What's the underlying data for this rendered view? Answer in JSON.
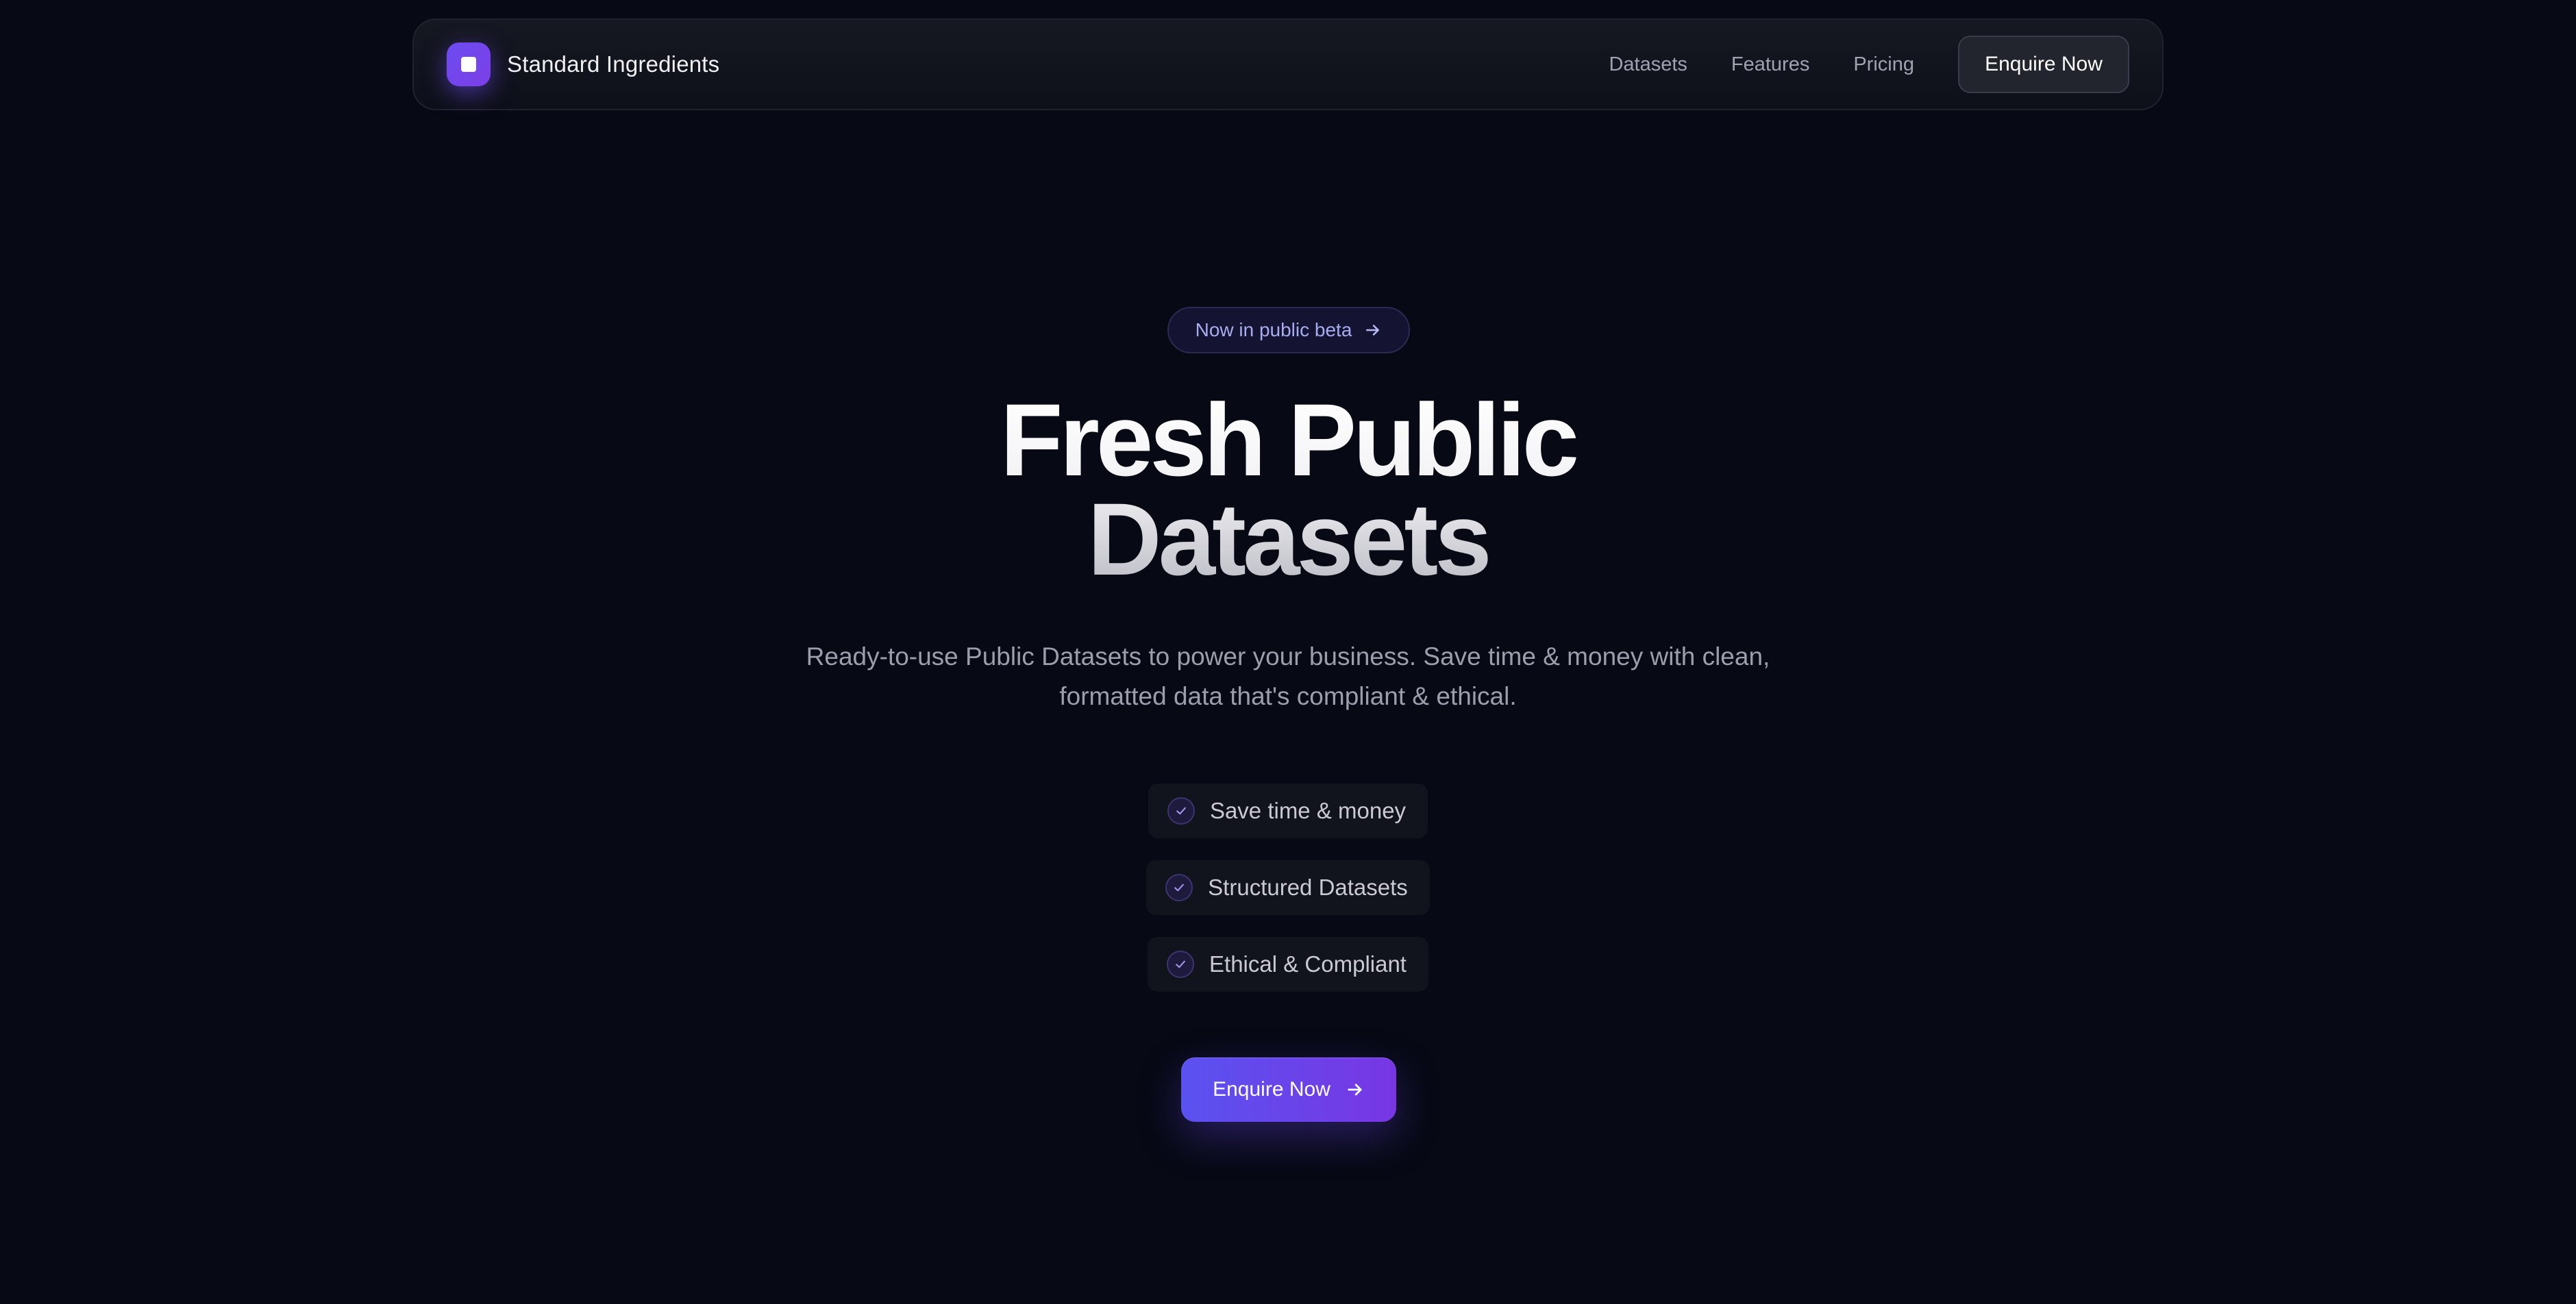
{
  "nav": {
    "brand_name": "Standard Ingredients",
    "logo_icon": "square-logo-icon",
    "links": [
      {
        "label": "Datasets"
      },
      {
        "label": "Features"
      },
      {
        "label": "Pricing"
      }
    ],
    "cta_label": "Enquire Now"
  },
  "hero": {
    "badge_label": "Now in public beta",
    "badge_icon": "arrow-right-icon",
    "title_line1": "Fresh Public",
    "title_line2": "Datasets",
    "subtitle": "Ready-to-use Public Datasets to power your business. Save time & money with clean, formatted data that's compliant & ethical.",
    "features": [
      {
        "label": "Save time & money",
        "icon": "check-icon"
      },
      {
        "label": "Structured Datasets",
        "icon": "check-icon"
      },
      {
        "label": "Ethical & Compliant",
        "icon": "check-icon"
      }
    ],
    "cta_label": "Enquire Now",
    "cta_icon": "arrow-right-icon"
  },
  "colors": {
    "background": "#070914",
    "accent_start": "#5a52f0",
    "accent_end": "#7836e3",
    "badge_text": "#a8acee"
  }
}
